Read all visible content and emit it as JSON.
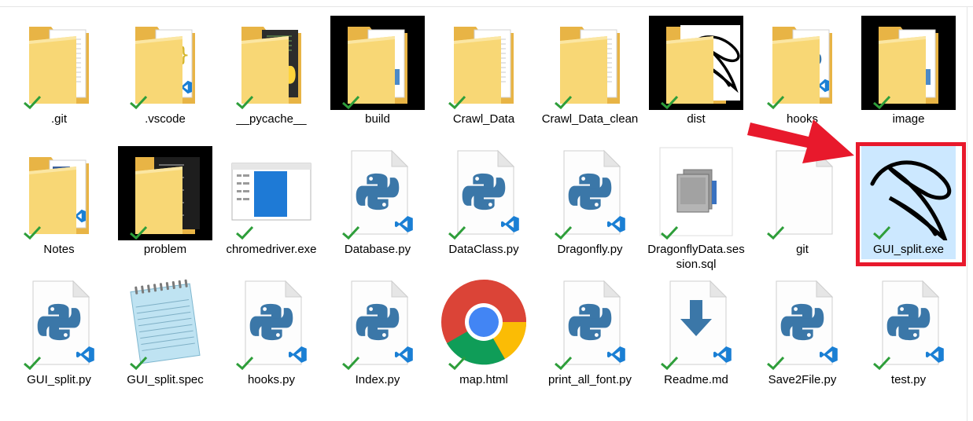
{
  "files": [
    {
      "name": ".git",
      "icon": "folder-icon",
      "kind": "folder-doc",
      "synced": true
    },
    {
      "name": ".vscode",
      "icon": "folder-vscode-icon",
      "kind": "folder-vscode",
      "synced": true
    },
    {
      "name": "__pycache__",
      "icon": "folder-python-icon",
      "kind": "folder-python",
      "synced": true
    },
    {
      "name": "build",
      "icon": "folder-build-icon",
      "kind": "folder-dark",
      "synced": true
    },
    {
      "name": "Crawl_Data",
      "icon": "folder-document-icon",
      "kind": "folder-doc",
      "synced": true
    },
    {
      "name": "Crawl_Data_clean",
      "icon": "folder-document-icon",
      "kind": "folder-doc",
      "synced": true
    },
    {
      "name": "dist",
      "icon": "folder-dist-icon",
      "kind": "folder-dark-logo",
      "synced": true
    },
    {
      "name": "hooks",
      "icon": "folder-python-vscode-icon",
      "kind": "folder-pyvs",
      "synced": true
    },
    {
      "name": "image",
      "icon": "folder-image-icon",
      "kind": "folder-dark",
      "synced": true
    },
    {
      "name": "Notes",
      "icon": "folder-notes-icon",
      "kind": "folder-notes",
      "synced": true
    },
    {
      "name": "problem",
      "icon": "folder-problem-icon",
      "kind": "folder-dark-terminal",
      "synced": true
    },
    {
      "name": "chromedriver.exe",
      "icon": "window-app-icon",
      "kind": "window",
      "synced": true
    },
    {
      "name": "Database.py",
      "icon": "python-file-icon",
      "kind": "pyfile",
      "synced": true
    },
    {
      "name": "DataClass.py",
      "icon": "python-file-icon",
      "kind": "pyfile",
      "synced": true
    },
    {
      "name": "Dragonfly.py",
      "icon": "python-file-icon",
      "kind": "pyfile",
      "synced": true
    },
    {
      "name": "DragonflyData.session.sql",
      "icon": "sql-file-icon",
      "kind": "sqlfile",
      "synced": true
    },
    {
      "name": "git",
      "icon": "blank-file-icon",
      "kind": "blank",
      "synced": true
    },
    {
      "name": "GUI_split.exe",
      "icon": "app-logo-icon",
      "kind": "exe-logo",
      "synced": true,
      "selected": true
    },
    {
      "name": "GUI_split.py",
      "icon": "python-file-icon",
      "kind": "pyfile",
      "synced": true
    },
    {
      "name": "GUI_split.spec",
      "icon": "notepad-icon",
      "kind": "notepad",
      "synced": true
    },
    {
      "name": "hooks.py",
      "icon": "python-file-icon",
      "kind": "pyfile",
      "synced": true
    },
    {
      "name": "Index.py",
      "icon": "python-file-icon",
      "kind": "pyfile",
      "synced": true
    },
    {
      "name": "map.html",
      "icon": "chrome-icon",
      "kind": "chrome",
      "synced": true
    },
    {
      "name": "print_all_font.py",
      "icon": "python-file-icon",
      "kind": "pyfile",
      "synced": true
    },
    {
      "name": "Readme.md",
      "icon": "markdown-file-icon",
      "kind": "mdfile",
      "synced": true
    },
    {
      "name": "Save2File.py",
      "icon": "python-file-icon",
      "kind": "pyfile",
      "synced": true
    },
    {
      "name": "test.py",
      "icon": "python-file-icon",
      "kind": "pyfile",
      "synced": true
    }
  ],
  "colors": {
    "selection": "#cce8ff",
    "highlight_border": "#e8192c",
    "arrow": "#e8192c",
    "sync_check": "#2e9e3a",
    "folder": "#f8d775",
    "python_blue": "#3776ab",
    "python_yellow": "#ffd43b",
    "vscode_blue": "#007acc"
  }
}
